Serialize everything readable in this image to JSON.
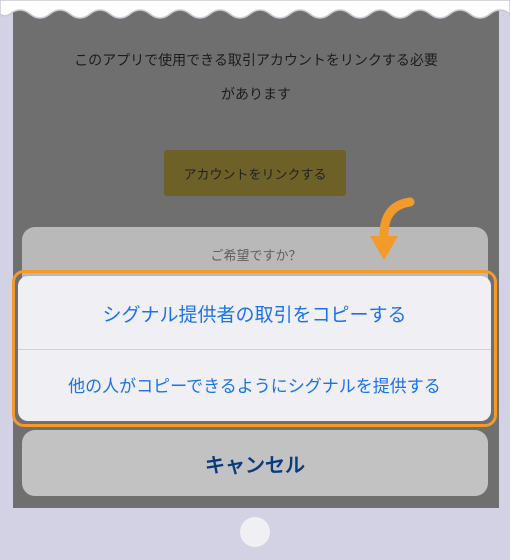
{
  "screen": {
    "message_line1": "このアプリで使用できる取引アカウントをリンクする必要",
    "message_line2": "があります",
    "link_button_label": "アカウントをリンクする"
  },
  "action_sheet": {
    "title": "ご希望ですか？",
    "options": [
      {
        "label": "シグナル提供者の取引をコピーする"
      },
      {
        "label": "他の人がコピーできるようにシグナルを提供する"
      }
    ],
    "cancel_label": "キャンセル"
  },
  "colors": {
    "highlight": "#f39a2a",
    "option_text": "#1a73e8",
    "cancel_text": "#0a3a7a",
    "device_frame": "#d2d2e4"
  },
  "icons": {
    "arrow": "curved-arrow-down-icon"
  }
}
